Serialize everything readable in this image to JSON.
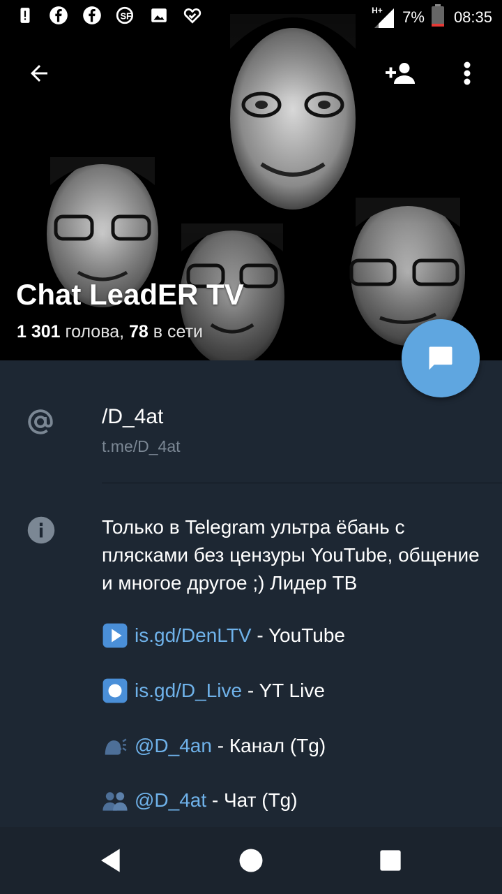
{
  "status_bar": {
    "network": "H+",
    "battery": "7%",
    "time": "08:35",
    "left_icons": [
      "alert-icon",
      "facebook-icon",
      "facebook-icon",
      "sf-icon",
      "image-icon",
      "heart-icon"
    ]
  },
  "header": {
    "title": "Chat LeadER TV",
    "members_count": "1 301",
    "members_label": "голова,",
    "online_count": "78",
    "online_label": "в сети"
  },
  "info": {
    "username": "/D_4at",
    "link": "t.me/D_4at",
    "description": "Только в Telegram ультра ёбань с плясками без цензуры YouTube, общение и многое другое ;) Лидер ТВ",
    "links": [
      {
        "emoji": "play-button-emoji",
        "url": "is.gd/DenLTV",
        "text": " - YouTube"
      },
      {
        "emoji": "record-button-emoji",
        "url": "is.gd/D_Live",
        "text": " - YT Live"
      },
      {
        "emoji": "speaking-head-emoji",
        "url": "@D_4an",
        "text": " - Канал (Tg)"
      },
      {
        "emoji": "two-people-emoji",
        "url": "@D_4at",
        "text": " - Чат (Tg)"
      }
    ]
  },
  "colors": {
    "background": "#1d2733",
    "accent": "#5fa6e0",
    "link": "#6fb2ea",
    "secondary_text": "#7b8794"
  }
}
